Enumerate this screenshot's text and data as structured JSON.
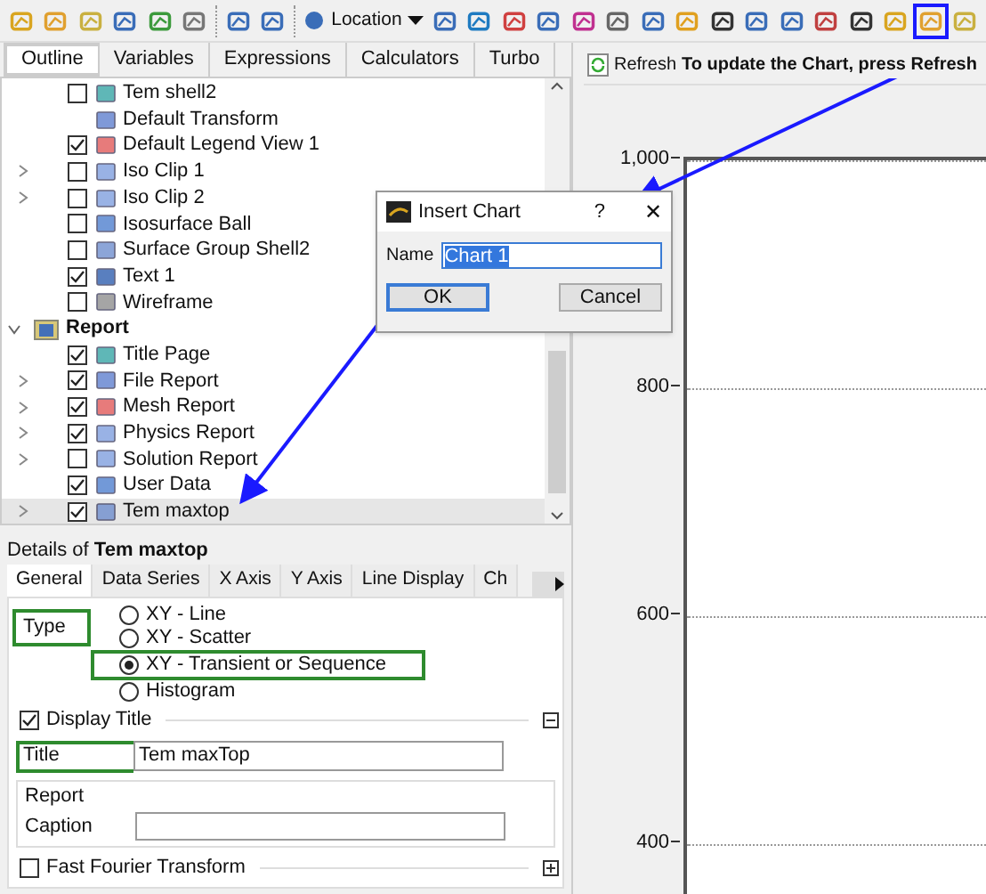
{
  "toolbar": {
    "items": [
      {
        "kind": "icon",
        "highlighted": false
      },
      {
        "kind": "icon",
        "highlighted": false
      },
      {
        "kind": "icon",
        "highlighted": false
      },
      {
        "kind": "icon",
        "highlighted": false
      },
      {
        "kind": "icon",
        "highlighted": false
      },
      {
        "kind": "icon",
        "highlighted": false
      },
      {
        "kind": "separator"
      },
      {
        "kind": "icon",
        "highlighted": false
      },
      {
        "kind": "icon",
        "highlighted": false
      },
      {
        "kind": "separator"
      },
      {
        "kind": "dropdown",
        "label": "Location",
        "highlighted": false
      },
      {
        "kind": "icon",
        "highlighted": false
      },
      {
        "kind": "icon",
        "highlighted": false
      },
      {
        "kind": "icon",
        "highlighted": false
      },
      {
        "kind": "icon",
        "highlighted": false
      },
      {
        "kind": "icon",
        "highlighted": false
      },
      {
        "kind": "icon",
        "highlighted": false
      },
      {
        "kind": "icon",
        "highlighted": false
      },
      {
        "kind": "icon",
        "highlighted": false
      },
      {
        "kind": "icon",
        "highlighted": false
      },
      {
        "kind": "icon",
        "highlighted": false
      },
      {
        "kind": "icon",
        "highlighted": false
      },
      {
        "kind": "icon",
        "highlighted": false
      },
      {
        "kind": "icon",
        "highlighted": false
      },
      {
        "kind": "icon",
        "highlighted": false
      },
      {
        "kind": "icon",
        "highlighted": true
      },
      {
        "kind": "icon",
        "highlighted": false
      }
    ]
  },
  "tabs": [
    {
      "label": "Outline",
      "selected": true,
      "highlighted": true
    },
    {
      "label": "Variables",
      "selected": false,
      "highlighted": false
    },
    {
      "label": "Expressions",
      "selected": false,
      "highlighted": false
    },
    {
      "label": "Calculators",
      "selected": false,
      "highlighted": false
    },
    {
      "label": "Turbo",
      "selected": false,
      "highlighted": false
    }
  ],
  "tree": {
    "items": [
      {
        "label": "Tem shell2",
        "checked": false,
        "expandable": false,
        "selected": false
      },
      {
        "label": "Default Transform",
        "expandable": false,
        "selected": false
      },
      {
        "label": "Default Legend View 1",
        "checked": true,
        "expandable": false,
        "selected": false
      },
      {
        "label": "Iso Clip 1",
        "checked": false,
        "expandable": true,
        "selected": false
      },
      {
        "label": "Iso Clip 2",
        "checked": false,
        "expandable": true,
        "selected": false
      },
      {
        "label": "Isosurface Ball",
        "checked": false,
        "expandable": false,
        "selected": false
      },
      {
        "label": "Surface Group Shell2",
        "checked": false,
        "expandable": false,
        "selected": false
      },
      {
        "label": "Text 1",
        "checked": true,
        "expandable": false,
        "selected": false
      },
      {
        "label": "Wireframe",
        "checked": false,
        "expandable": false,
        "selected": false
      }
    ],
    "folders": [
      {
        "label": "Report",
        "expanded": true,
        "children": [
          {
            "label": "Title Page",
            "checked": true,
            "expandable": false,
            "selected": false
          },
          {
            "label": "File Report",
            "checked": true,
            "expandable": true,
            "selected": false
          },
          {
            "label": "Mesh Report",
            "checked": true,
            "expandable": true,
            "selected": false
          },
          {
            "label": "Physics Report",
            "checked": true,
            "expandable": true,
            "selected": false
          },
          {
            "label": "Solution Report",
            "checked": false,
            "expandable": true,
            "selected": false
          },
          {
            "label": "User Data",
            "checked": true,
            "expandable": false,
            "selected": false
          },
          {
            "label": "Tem maxtop",
            "checked": true,
            "expandable": true,
            "selected": true
          }
        ]
      }
    ]
  },
  "details": {
    "prefix": "Details of",
    "object": "Tem maxtop",
    "tabs": [
      {
        "label": "General",
        "selected": true
      },
      {
        "label": "Data Series",
        "selected": false
      },
      {
        "label": "X Axis",
        "selected": false
      },
      {
        "label": "Y Axis",
        "selected": false
      },
      {
        "label": "Line Display",
        "selected": false
      },
      {
        "label": "Ch",
        "selected": false
      }
    ],
    "type_label": "Type",
    "type_options": [
      {
        "label": "XY - Line",
        "selected": false,
        "highlighted": false
      },
      {
        "label": "XY - Scatter",
        "selected": false,
        "highlighted": false
      },
      {
        "label": "XY - Transient or Sequence",
        "selected": true,
        "highlighted": true
      },
      {
        "label": "Histogram",
        "selected": false,
        "highlighted": false
      }
    ],
    "display_title": {
      "label": "Display Title",
      "checked": true,
      "expanded": true
    },
    "title_field": {
      "label": "Title",
      "value": "Tem maxTop"
    },
    "report_group": {
      "label": "Report",
      "caption_label": "Caption"
    },
    "fft": {
      "label": "Fast Fourier Transform",
      "checked": false,
      "expanded": false
    }
  },
  "chart_panel": {
    "refresh_label": "Refresh",
    "message": "To update the Chart, press Refresh",
    "y_labels": [
      "1,000",
      "800",
      "600",
      "400"
    ]
  },
  "dialog": {
    "title": "Insert Chart",
    "help": "?",
    "close": "✕",
    "name_label": "Name",
    "name_value": "Chart 1",
    "ok": "OK",
    "cancel": "Cancel"
  }
}
